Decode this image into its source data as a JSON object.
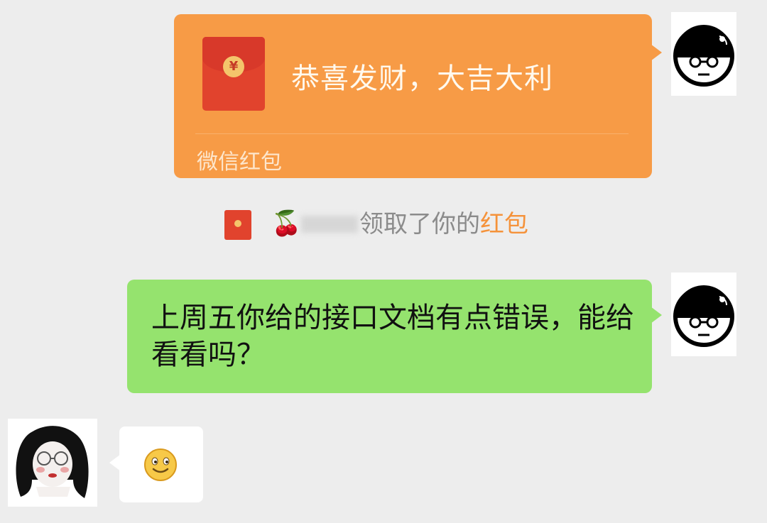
{
  "red_packet": {
    "greeting": "恭喜发财，大吉大利",
    "footer_label": "微信红包",
    "coin_symbol": "¥",
    "bubble_color": "#f79b46"
  },
  "notice": {
    "emoji": "🍒",
    "text": "领取了你的",
    "link_text": "红包",
    "link_color": "#f5923a"
  },
  "messages": [
    {
      "side": "right",
      "text": "上周五你给的接口文档有点错误，能给看看吗？",
      "bubble_color": "#95e36e"
    },
    {
      "side": "left",
      "content_icon": "smile-emoji-icon",
      "bubble_color": "#ffffff"
    }
  ],
  "background_color": "#ededed"
}
